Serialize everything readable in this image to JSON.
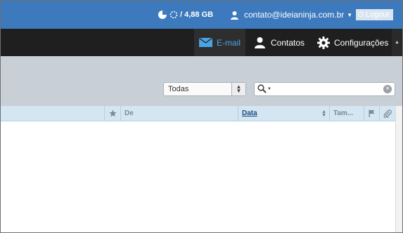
{
  "topbar": {
    "quota": "/ 4,88 GB",
    "user_email": "contato@ideianinja.com.br",
    "logout_label": "Logout"
  },
  "nav": {
    "email": "E-mail",
    "contacts": "Contatos",
    "settings": "Configurações"
  },
  "toolbar": {
    "filter_value": "Todas",
    "search_value": ""
  },
  "table": {
    "col_from": "De",
    "col_date": "Data",
    "col_size": "Tam..."
  },
  "colors": {
    "topbar": "#3d79bd",
    "navbar": "#1f1f1f",
    "nav_active_text": "#4aa3e6",
    "toolbar": "#c8cfd6",
    "header": "#d3e6f1"
  }
}
